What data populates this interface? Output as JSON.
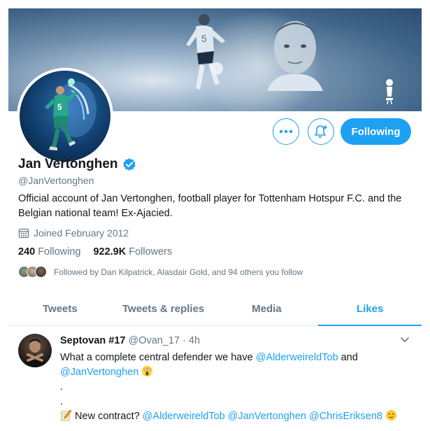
{
  "profile": {
    "display_name": "Jan Vertonghen",
    "handle": "@JanVertonghen",
    "bio": "Official account of Jan Vertonghen, football player for Tottenham Hotspur F.C. and the Belgian national team! Ex-Ajacied.",
    "joined": "Joined February 2012",
    "following_count": "240",
    "following_label": "Following",
    "followers_count": "922.9K",
    "followers_label": "Followers",
    "followed_by": "Followed by Dan Kilpatrick, Alasdair Gold, and 94 others you follow",
    "verified": true
  },
  "actions": {
    "following_label": "Following",
    "more_icon": "more-icon",
    "notify_icon": "bell-plus-icon"
  },
  "tabs": [
    {
      "label": "Tweets",
      "active": false
    },
    {
      "label": "Tweets & replies",
      "active": false
    },
    {
      "label": "Media",
      "active": false
    },
    {
      "label": "Likes",
      "active": true
    }
  ],
  "tweet": {
    "author": "Septovan #17",
    "handle": "@Ovan_17",
    "separator": "·",
    "time": "4h",
    "line1_text": "What a complete central defender we have ",
    "mention1": "@AlderweireldTob",
    "line1_and": " and",
    "mention2": "@JanVertonghen",
    "dot1": ".",
    "dot2": ".",
    "line4_text": "New contract? ",
    "mention3": "@AlderweireldTob",
    "mention4": "@JanVertonghen",
    "mention5": "@ChrisEriksen8"
  },
  "colors": {
    "accent": "#1da1f2",
    "text_primary": "#14171a",
    "text_secondary": "#657786"
  }
}
